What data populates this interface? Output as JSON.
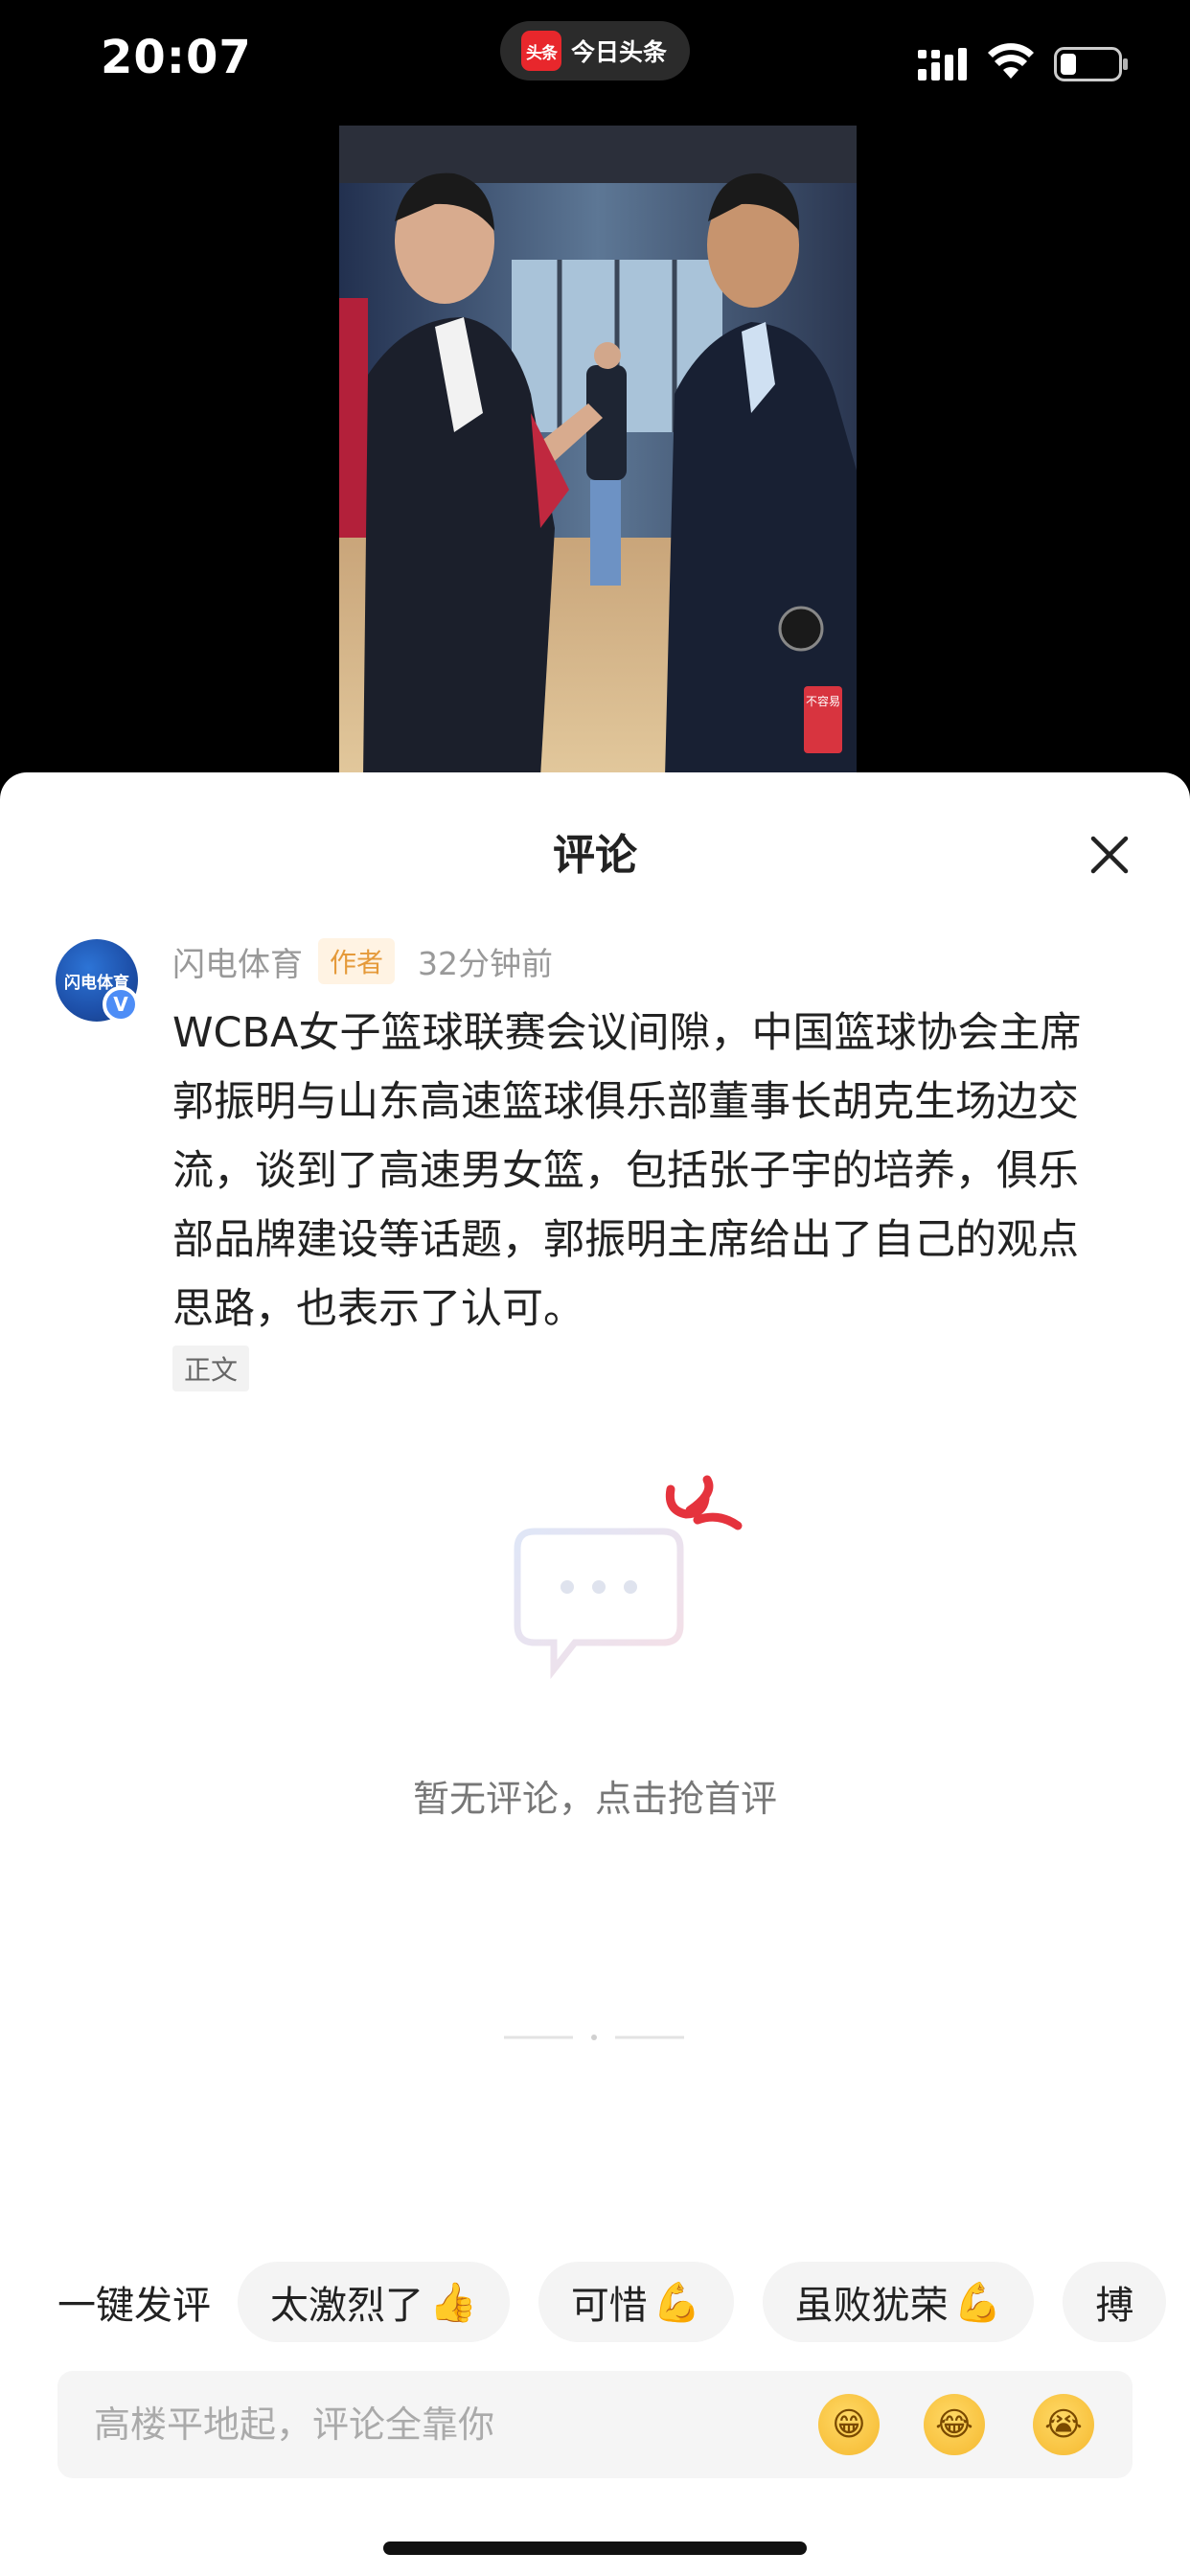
{
  "status_bar": {
    "time": "20:07",
    "app_badge": "头条",
    "app_name": "今日头条",
    "signal_icon": "cellular-signal",
    "wifi_icon": "wifi",
    "battery_icon": "battery-low"
  },
  "video": {
    "badge_text": "不容易"
  },
  "sheet": {
    "title": "评论",
    "close_icon": "close-x"
  },
  "post": {
    "avatar_text": "闪电体育",
    "verified_badge": "V",
    "author": "闪电体育",
    "author_tag": "作者",
    "time": "32分钟前",
    "body": "WCBA女子篮球联赛会议间隙，中国篮球协会主席郭振明与山东高速篮球俱乐部董事长胡克生场边交流，谈到了高速男女篮，包括张子宇的培养，俱乐部品牌建设等话题，郭振明主席给出了自己的观点思路，也表示了认可。",
    "body_tag": "正文"
  },
  "empty_state": {
    "text": "暂无评论，点击抢首评",
    "illustration_icon": "chat-bubble-empty"
  },
  "quick_comments": {
    "label": "一键发评",
    "chips": [
      {
        "text": "太激烈了",
        "emoji": "👍"
      },
      {
        "text": "可惜",
        "emoji": "💪"
      },
      {
        "text": "虽败犹荣",
        "emoji": "💪"
      },
      {
        "text": "搏",
        "emoji": ""
      }
    ]
  },
  "input": {
    "placeholder": "高楼平地起，评论全靠你",
    "emojis": [
      "😁",
      "😂",
      "😭"
    ]
  },
  "colors": {
    "accent_red": "#e8272c",
    "author_tag": "#e59a3a",
    "verified_blue": "#4d8df6"
  }
}
